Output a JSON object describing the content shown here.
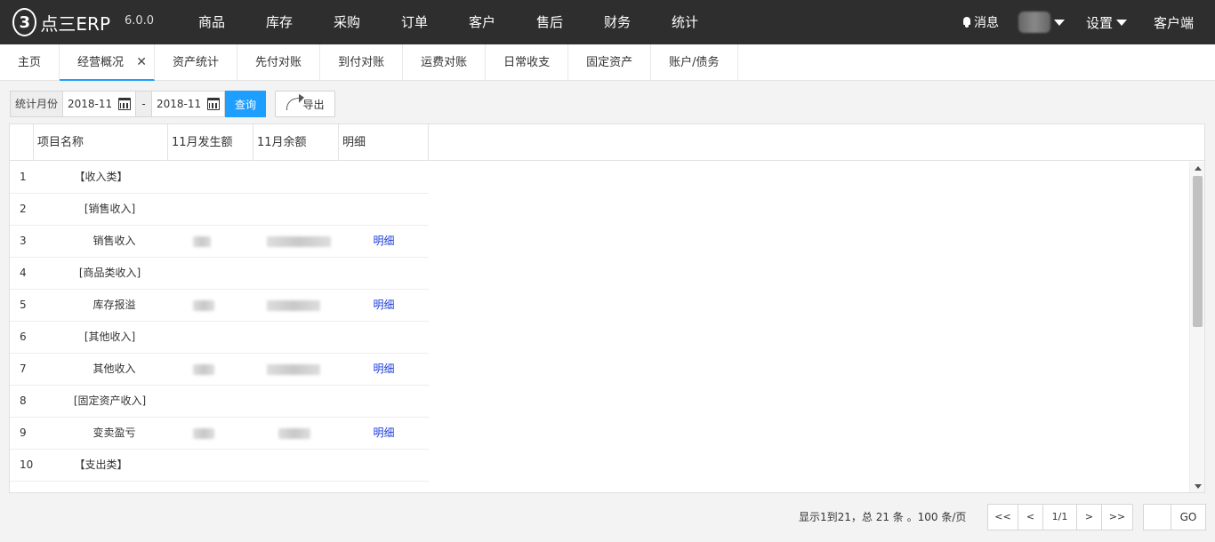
{
  "header": {
    "logo_mark": "3",
    "logo_text": "点三ERP",
    "version": "6.0.0",
    "nav": [
      "商品",
      "库存",
      "采购",
      "订单",
      "客户",
      "售后",
      "财务",
      "统计"
    ],
    "messages_label": "消息",
    "settings_label": "设置",
    "client_label": "客户端"
  },
  "tabs": [
    {
      "label": "主页",
      "active": false
    },
    {
      "label": "经营概况",
      "active": true,
      "close": "✕"
    },
    {
      "label": "资产统计",
      "active": false
    },
    {
      "label": "先付对账",
      "active": false
    },
    {
      "label": "到付对账",
      "active": false
    },
    {
      "label": "运费对账",
      "active": false
    },
    {
      "label": "日常收支",
      "active": false
    },
    {
      "label": "固定资产",
      "active": false
    },
    {
      "label": "账户/债务",
      "active": false
    }
  ],
  "filter": {
    "label": "统计月份",
    "start": "2018-11",
    "separator": "-",
    "end": "2018-11",
    "query_label": "查询",
    "export_label": "导出"
  },
  "table": {
    "columns": [
      "项目名称",
      "11月发生额",
      "11月余额",
      "明细"
    ],
    "rows": [
      {
        "idx": "1",
        "name": "【收入类】",
        "detail": ""
      },
      {
        "idx": "2",
        "name": "[销售收入]",
        "detail": ""
      },
      {
        "idx": "3",
        "name": "销售收入",
        "detail": "明细",
        "blurred": true
      },
      {
        "idx": "4",
        "name": "[商品类收入]",
        "detail": ""
      },
      {
        "idx": "5",
        "name": "库存报溢",
        "detail": "明细",
        "blurred": true
      },
      {
        "idx": "6",
        "name": "[其他收入]",
        "detail": ""
      },
      {
        "idx": "7",
        "name": "其他收入",
        "detail": "明细",
        "blurred": true
      },
      {
        "idx": "8",
        "name": "[固定资产收入]",
        "detail": ""
      },
      {
        "idx": "9",
        "name": "变卖盈亏",
        "detail": "明细",
        "blurred": true
      },
      {
        "idx": "10",
        "name": "【支出类】",
        "detail": ""
      }
    ]
  },
  "pager": {
    "info": "显示1到21，总 21 条 。100 条/页",
    "first": "<<",
    "prev": "<",
    "current": "1/1",
    "next": ">",
    "last": ">>",
    "go_label": "GO"
  }
}
